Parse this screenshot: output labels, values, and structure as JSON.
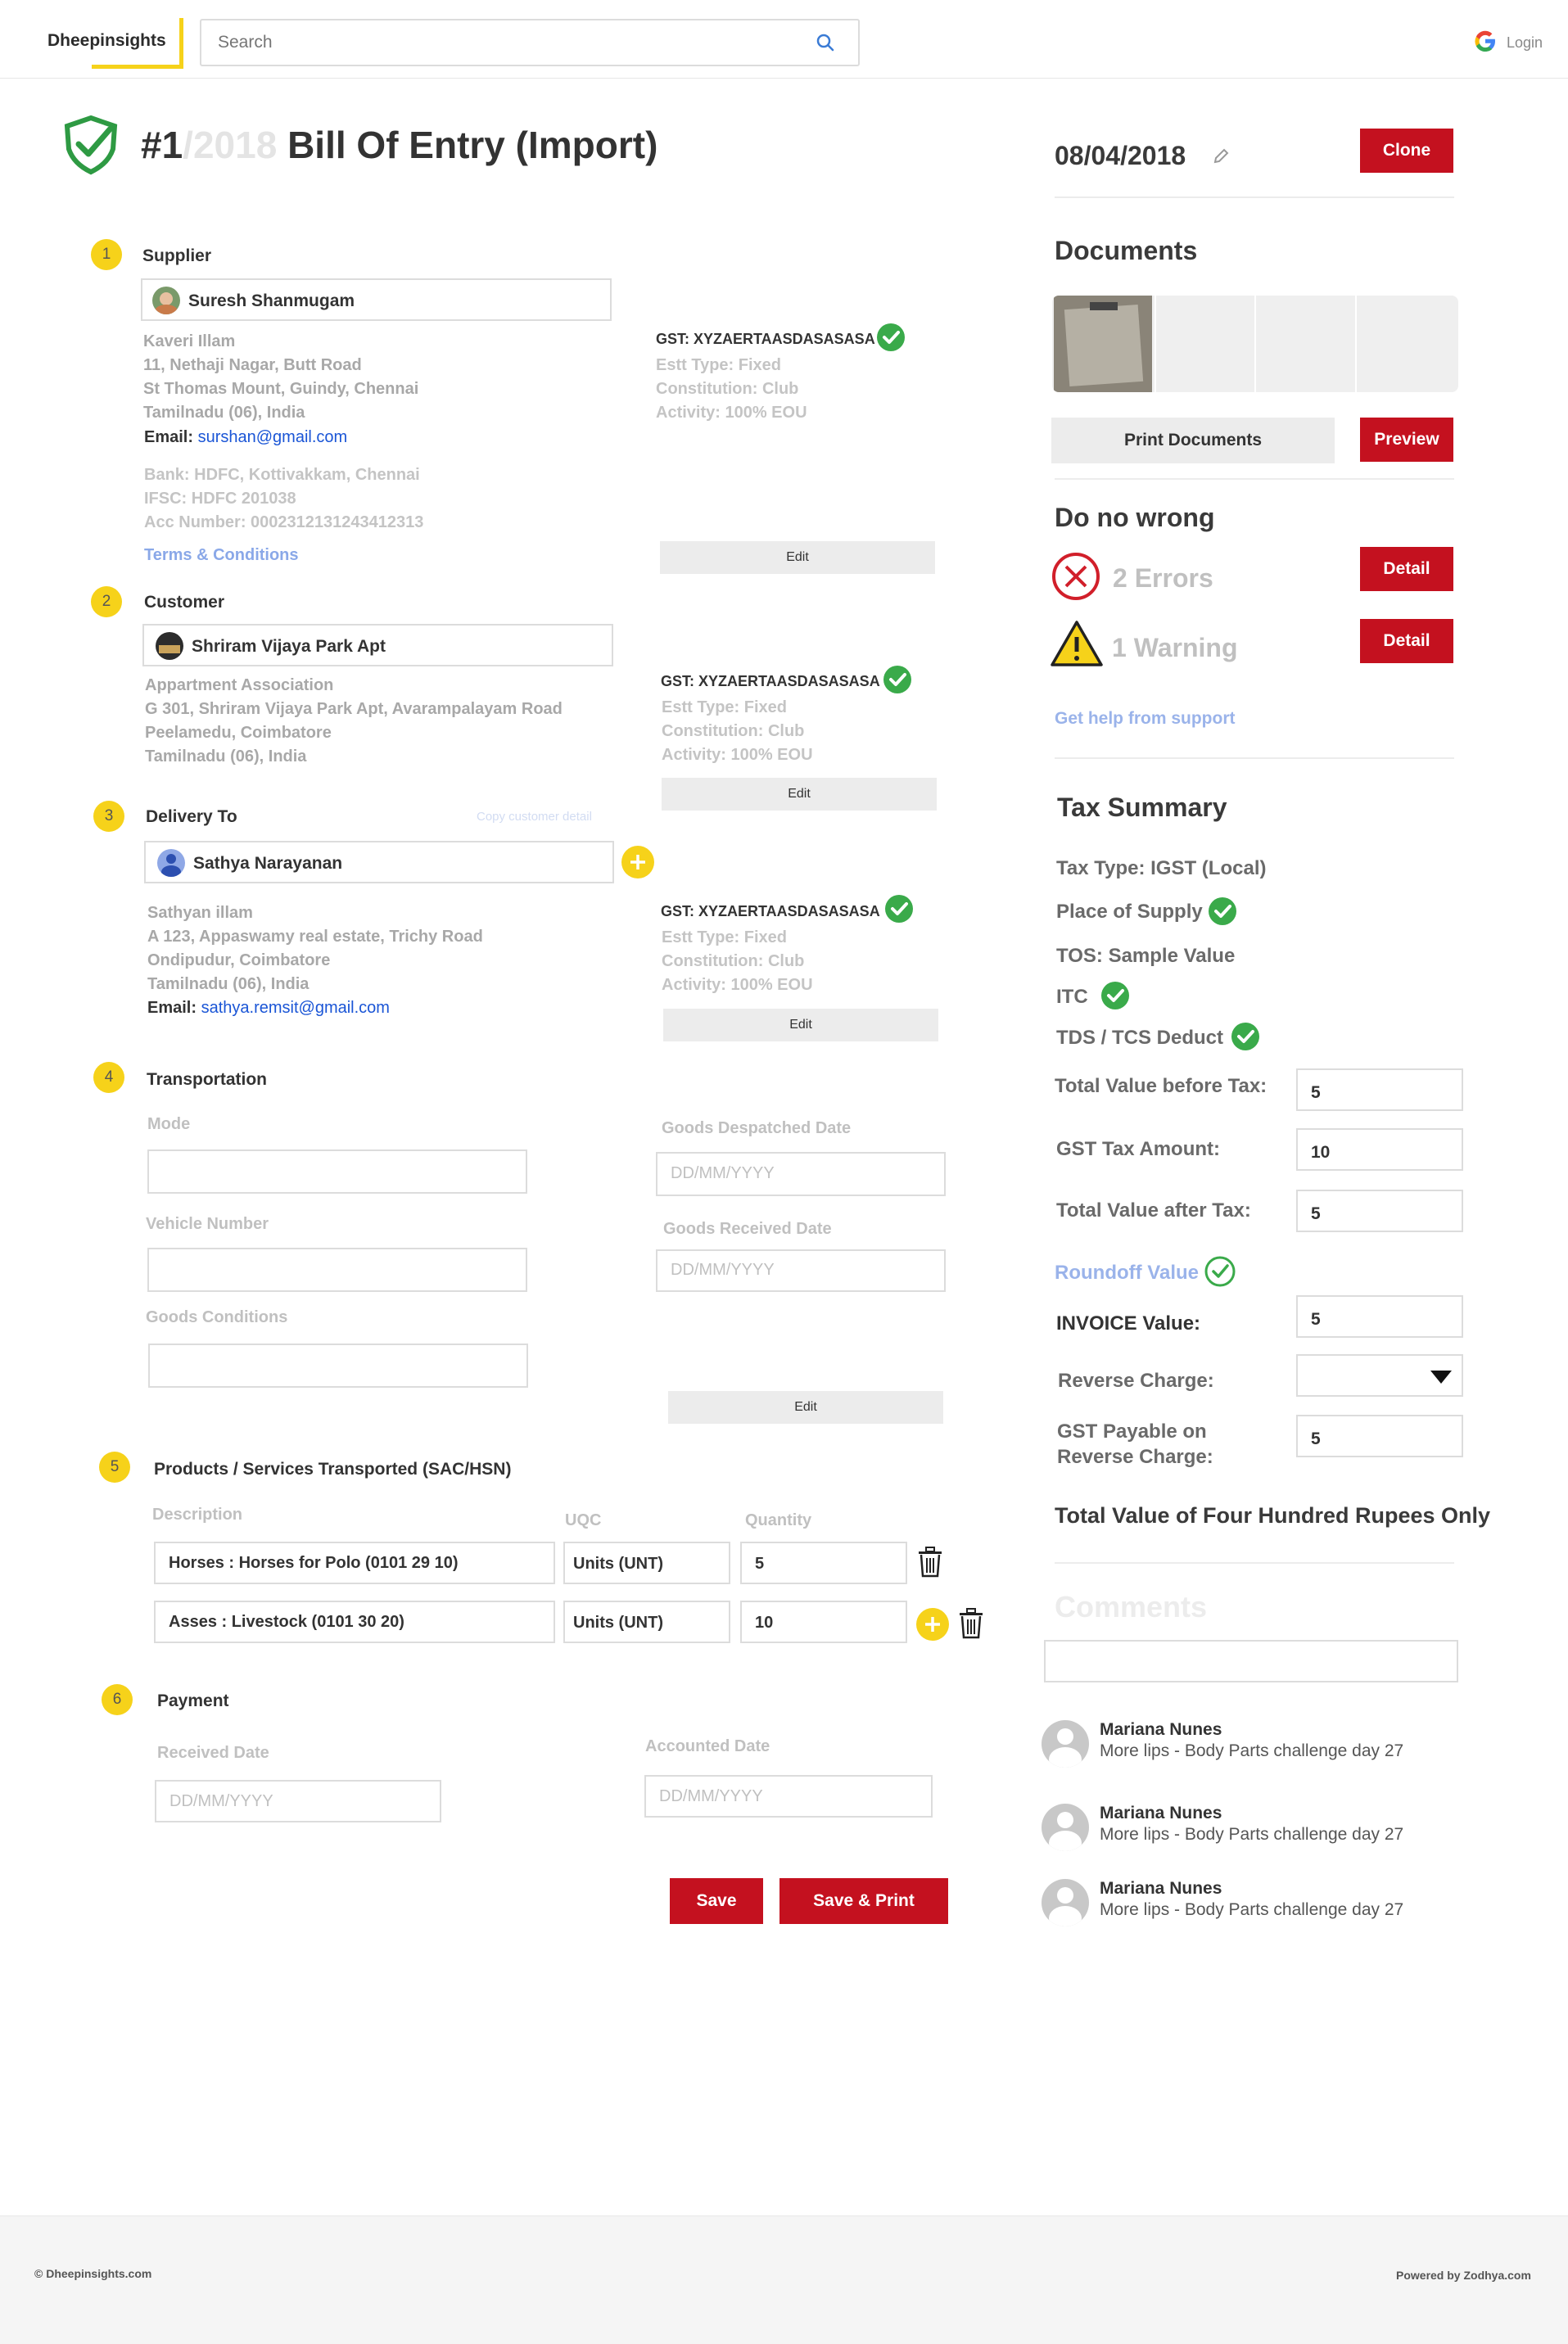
{
  "header": {
    "brand": "Dheepinsights",
    "search_placeholder": "Search",
    "login_label": "Login"
  },
  "doc": {
    "number": "#1",
    "year": "/2018",
    "title": "Bill Of Entry (Import)",
    "date": "08/04/2018",
    "clone_label": "Clone"
  },
  "supplier": {
    "step": "1",
    "heading": "Supplier",
    "name": "Suresh Shanmugam",
    "address": [
      "Kaveri Illam",
      "11, Nethaji Nagar, Butt Road",
      "St Thomas Mount, Guindy, Chennai",
      "Tamilnadu (06), India"
    ],
    "email_label": "Email:",
    "email": "surshan@gmail.com",
    "bank": [
      "Bank: HDFC, Kottivakkam, Chennai",
      "IFSC: HDFC 201038",
      "Acc Number: 0002312131243412313"
    ],
    "terms_label": "Terms & Conditions",
    "gst": "GST: XYZAERTAASDASASASA",
    "estt": "Estt Type: Fixed",
    "constitution": "Constitution: Club",
    "activity": "Activity: 100% EOU",
    "edit_label": "Edit"
  },
  "customer": {
    "step": "2",
    "heading": "Customer",
    "name": "Shriram Vijaya Park Apt",
    "address": [
      "Appartment Association",
      "G 301, Shriram Vijaya Park Apt, Avarampalayam Road",
      "Peelamedu, Coimbatore",
      "Tamilnadu (06), India"
    ],
    "gst": "GST: XYZAERTAASDASASASA",
    "estt": "Estt Type: Fixed",
    "constitution": "Constitution: Club",
    "activity": "Activity: 100% EOU",
    "edit_label": "Edit"
  },
  "delivery": {
    "step": "3",
    "heading": "Delivery To",
    "copy_label": "Copy customer detail",
    "name": "Sathya Narayanan",
    "address": [
      "Sathyan illam",
      "A 123, Appaswamy real estate, Trichy Road",
      "Ondipudur, Coimbatore",
      "Tamilnadu (06), India"
    ],
    "email_label": "Email:",
    "email": "sathya.remsit@gmail.com",
    "gst": "GST: XYZAERTAASDASASASA",
    "estt": "Estt Type: Fixed",
    "constitution": "Constitution: Club",
    "activity": "Activity: 100% EOU",
    "edit_label": "Edit"
  },
  "transport": {
    "step": "4",
    "heading": "Transportation",
    "mode_label": "Mode",
    "vehicle_label": "Vehicle Number",
    "conditions_label": "Goods Conditions",
    "despatched_label": "Goods Despatched Date",
    "received_label": "Goods Received Date",
    "date_placeholder": "DD/MM/YYYY",
    "edit_label": "Edit"
  },
  "products": {
    "step": "5",
    "heading": "Products / Services Transported (SAC/HSN)",
    "col_description": "Description",
    "col_uqc": "UQC",
    "col_quantity": "Quantity",
    "rows": [
      {
        "description": "Horses : Horses for Polo (0101 29 10)",
        "uqc": "Units (UNT)",
        "quantity": "5"
      },
      {
        "description": "Asses : Livestock  (0101 30 20)",
        "uqc": "Units (UNT)",
        "quantity": "10"
      }
    ]
  },
  "payment": {
    "step": "6",
    "heading": "Payment",
    "received_label": "Received Date",
    "accounted_label": "Accounted Date",
    "date_placeholder": "DD/MM/YYYY"
  },
  "actions": {
    "save_label": "Save",
    "save_print_label": "Save & Print"
  },
  "documents": {
    "heading": "Documents",
    "print_label": "Print Documents",
    "preview_label": "Preview"
  },
  "checks": {
    "heading": "Do no wrong",
    "errors": "2 Errors",
    "warnings": "1 Warning",
    "detail_label": "Detail",
    "help_label": "Get help from support"
  },
  "tax": {
    "heading": "Tax Summary",
    "tax_type": "Tax Type: IGST (Local)",
    "place_of_supply": "Place of Supply",
    "tos": "TOS: Sample Value",
    "itc": "ITC",
    "tds": "TDS / TCS Deduct",
    "before_label": "Total Value before Tax:",
    "before_value": "5",
    "gst_label": "GST Tax Amount:",
    "gst_value": "10",
    "after_label": "Total Value after Tax:",
    "after_value": "5",
    "roundoff_label": "Roundoff Value",
    "invoice_label": "INVOICE Value:",
    "invoice_value": "5",
    "reverse_label": "Reverse Charge:",
    "payable_label_1": "GST Payable on",
    "payable_label_2": "Reverse Charge:",
    "payable_value": "5",
    "words": "Total Value of Four Hundred Rupees Only"
  },
  "comments": {
    "heading": "Comments",
    "items": [
      {
        "name": "Mariana Nunes",
        "text": "More lips - Body Parts challenge day 27"
      },
      {
        "name": "Mariana Nunes",
        "text": "More lips - Body Parts challenge day 27"
      },
      {
        "name": "Mariana Nunes",
        "text": "More lips - Body Parts challenge day 27"
      }
    ]
  },
  "footer": {
    "copyright": "© Dheepinsights.com",
    "powered": "Powered by Zodhya.com"
  },
  "colors": {
    "accent": "#f6d21a",
    "danger": "#c4111f",
    "success": "#3aaa4a",
    "link": "#1a55d6"
  }
}
